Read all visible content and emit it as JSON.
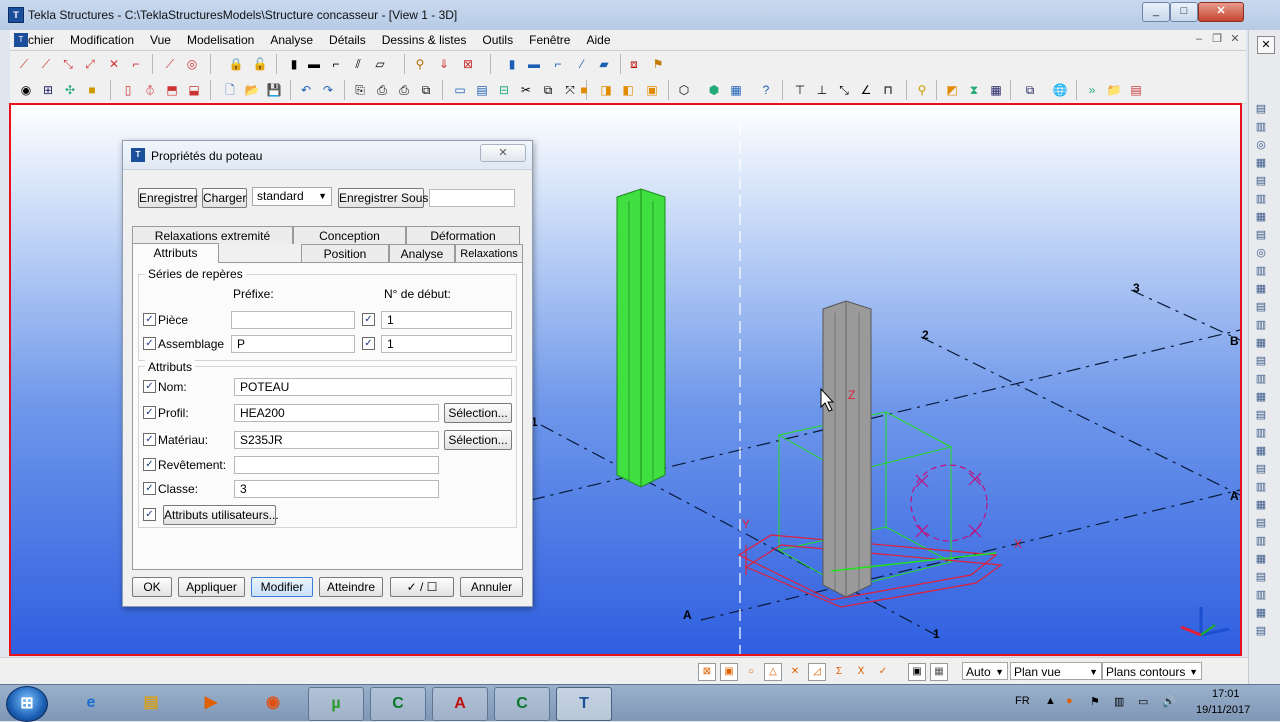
{
  "window": {
    "title": "Tekla Structures - C:\\TeklaStructuresModels\\Structure concasseur - [View 1 - 3D]",
    "app_icon": "tekla-app-icon"
  },
  "menu": {
    "items": [
      "Fichier",
      "Modification",
      "Vue",
      "Modelisation",
      "Analyse",
      "Détails",
      "Dessins & listes",
      "Outils",
      "Fenêtre",
      "Aide"
    ]
  },
  "viewport": {
    "grid_labels": [
      "3",
      "2",
      "1",
      "A",
      "B",
      "A",
      "1"
    ],
    "axis_labels": {
      "z": "Z",
      "x": "X",
      "y": "Y"
    },
    "border_color": "#e8101b"
  },
  "dialog": {
    "title": "Propriétés du poteau",
    "buttons_top": {
      "save": "Enregistrer",
      "load": "Charger",
      "save_as": "Enregistrer Sous"
    },
    "preset": {
      "selected": "standard"
    },
    "save_as_name": "",
    "tabs_back": [
      "Relaxations extremité",
      "Conception",
      "Déformation"
    ],
    "tabs_front": [
      "Attributs",
      "Position",
      "Analyse",
      "Relaxations origine"
    ],
    "numbering": {
      "group_title": "Séries de repères",
      "prefix_header": "Préfixe:",
      "start_header": "N° de début:",
      "part": {
        "label": "Pièce",
        "prefix": "",
        "start": "1"
      },
      "assembly": {
        "label": "Assemblage",
        "prefix": "P",
        "start": "1"
      }
    },
    "attributes": {
      "group_title": "Attributs",
      "name": {
        "label": "Nom:",
        "value": "POTEAU"
      },
      "profile": {
        "label": "Profil:",
        "value": "HEA200",
        "select": "Sélection..."
      },
      "material": {
        "label": "Matériau:",
        "value": "S235JR",
        "select": "Sélection..."
      },
      "finish": {
        "label": "Revêtement:",
        "value": ""
      },
      "class": {
        "label": "Classe:",
        "value": "3"
      },
      "user_attributes": "Attributs utilisateurs..."
    },
    "bottom_buttons": {
      "ok": "OK",
      "apply": "Appliquer",
      "modify": "Modifier",
      "get": "Atteindre",
      "toggle": "✓ / ☐",
      "cancel": "Annuler"
    }
  },
  "statusbar": {
    "snap_mode": "Auto",
    "plane": "Plan vue",
    "contour": "Plans contours"
  },
  "taskbar": {
    "language": "FR",
    "time": "17:01",
    "date": "19/11/2017"
  }
}
